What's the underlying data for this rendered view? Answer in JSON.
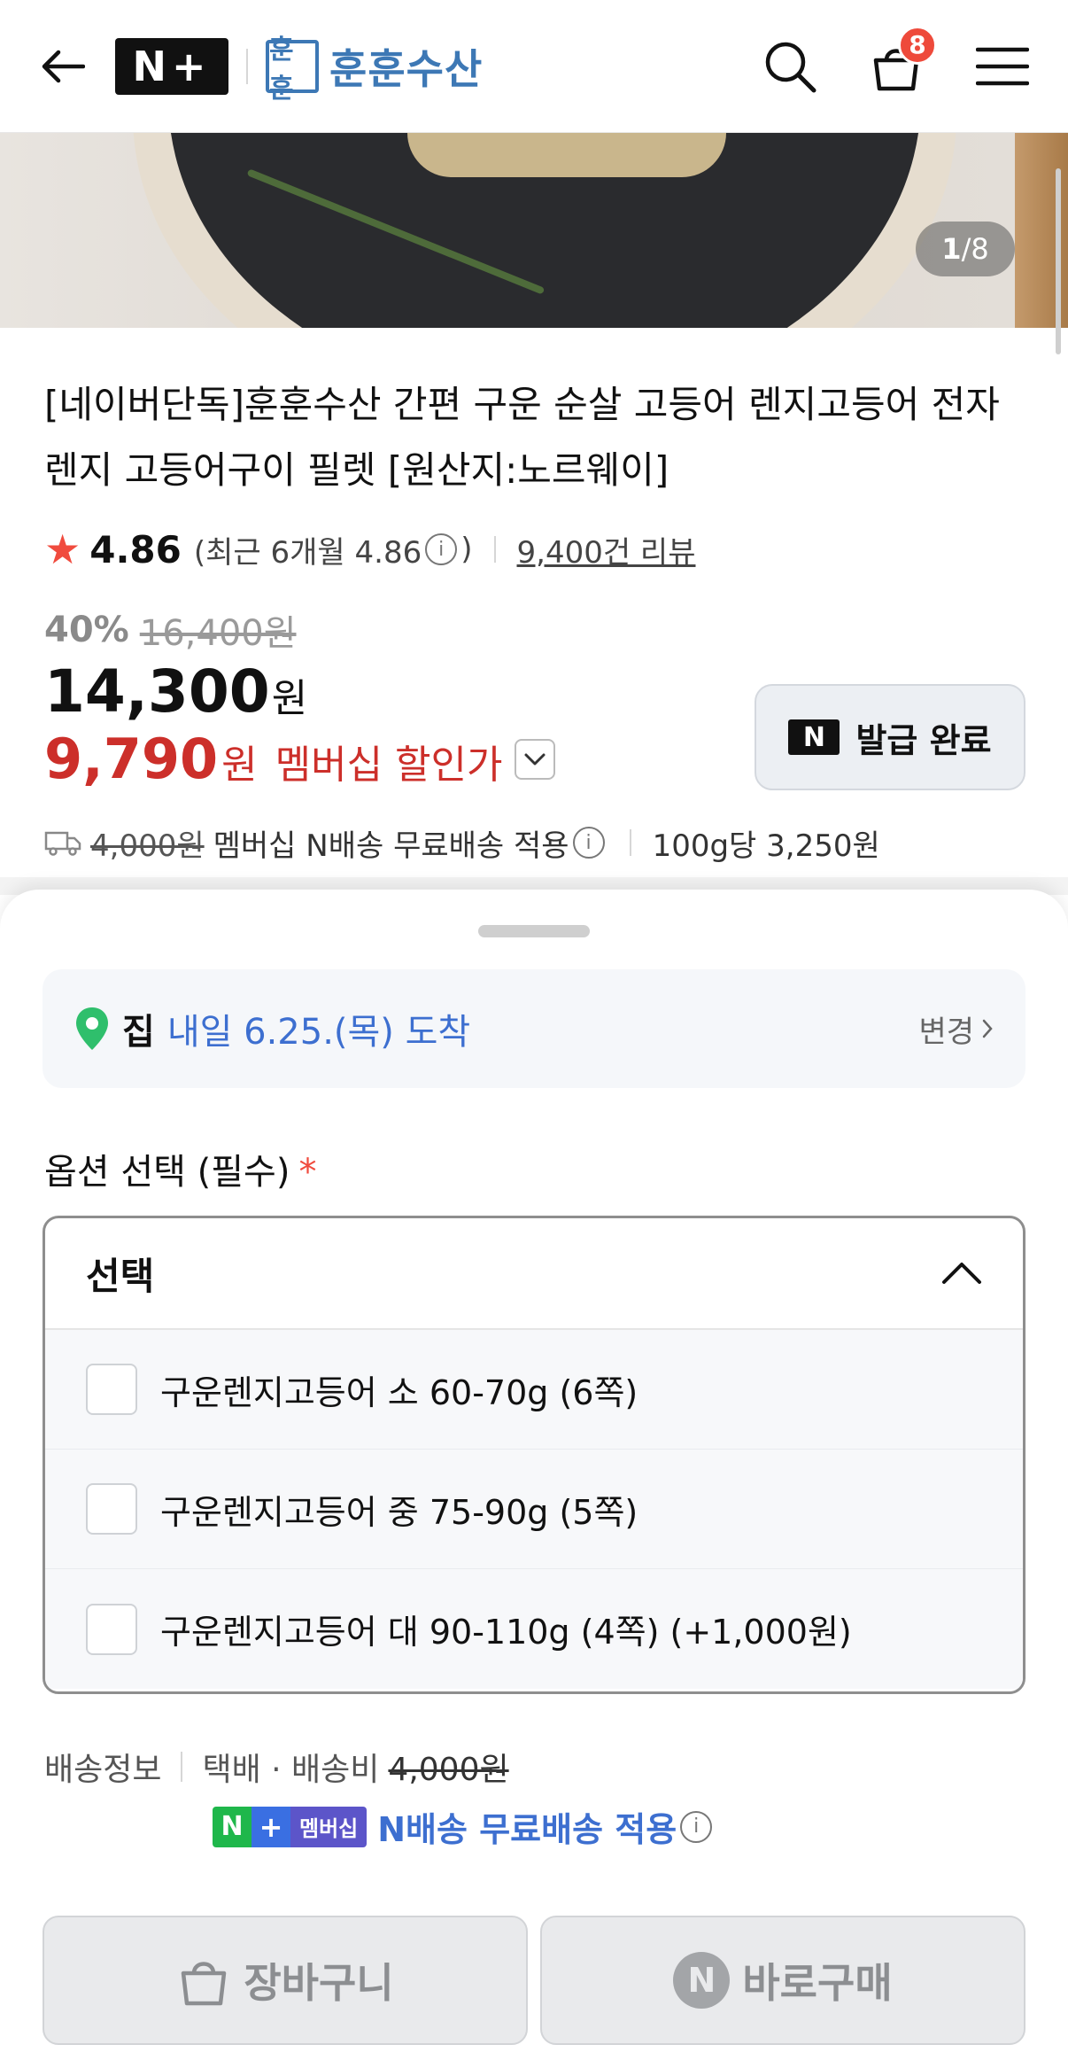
{
  "header": {
    "nplus_label": "N+",
    "brand_logo": "훈훈",
    "brand_name": "훈훈수산",
    "cart_count": "8"
  },
  "hero": {
    "counter_current": "1",
    "counter_total": "/8"
  },
  "product": {
    "title": "[네이버단독]훈훈수산 간편 구운 순살 고등어 렌지고등어 전자렌지 고등어구이 필렛 [원산지:노르웨이]",
    "rating": "4.86",
    "recent_rating_prefix": "(최근 6개월 4.86",
    "recent_rating_suffix": ")",
    "review_link": "9,400건 리뷰",
    "discount_pct": "40%",
    "original_price": "16,400원",
    "price": "14,300",
    "price_unit": "원",
    "member_price": "9,790",
    "member_price_unit": "원",
    "member_price_label": "멤버십 할인가",
    "coupon_button": "발급 완료",
    "coupon_badge": "N",
    "shipping_strike": "4,000원",
    "shipping_text": "멤버십 N배송 무료배송 적용",
    "unit_price": "100g당 3,250원"
  },
  "sheet": {
    "delivery_home": "집",
    "delivery_date": "내일 6.25.(목) 도착",
    "delivery_change": "변경",
    "option_label": "옵션 선택 (필수)",
    "required_mark": "*",
    "select_placeholder": "선택",
    "options": [
      {
        "label": "구운렌지고등어 소 60-70g (6쪽)"
      },
      {
        "label": "구운렌지고등어 중 75-90g (5쪽)"
      },
      {
        "label": "구운렌지고등어 대 90-110g (4쪽) (+1,000원)"
      }
    ],
    "shipping_info_label": "배송정보",
    "shipping_method": "택배 · 배송비",
    "shipping_fee_strike": "4,000원",
    "np_tag_n": "N",
    "np_tag_plus": "+",
    "np_tag_member": "멤버십",
    "np_free_text": "N배송 무료배송 적용",
    "cart_button": "장바구니",
    "buy_button": "바로구매",
    "buy_badge": "N"
  }
}
